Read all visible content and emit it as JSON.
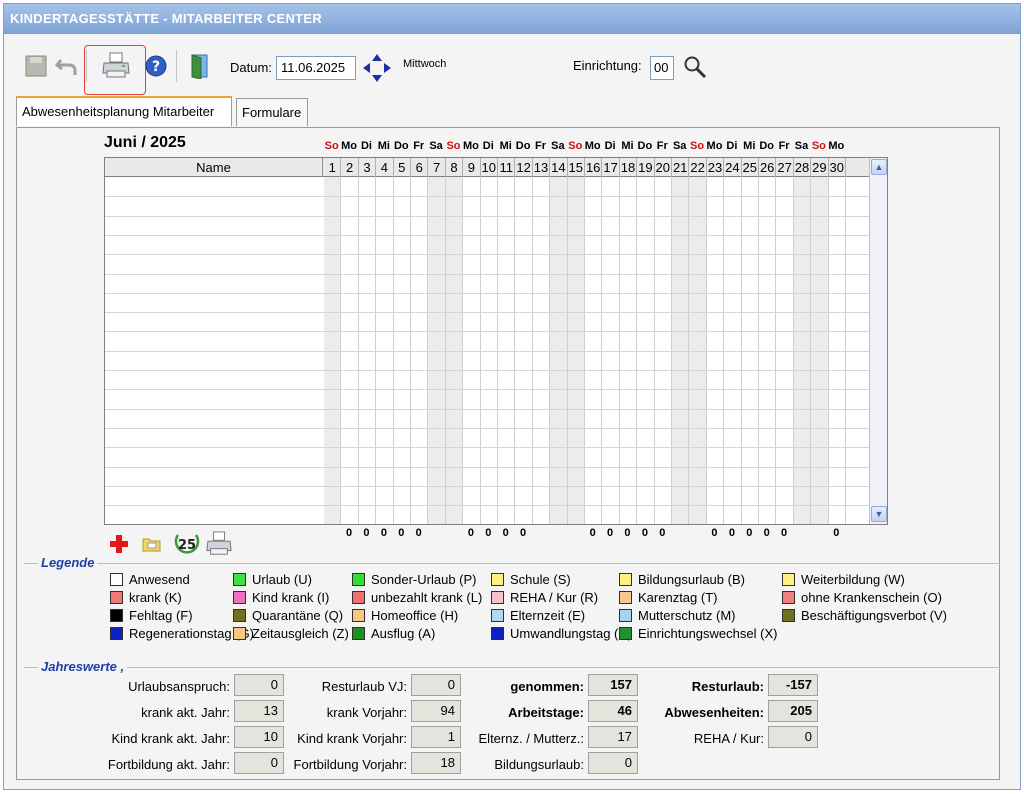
{
  "window": {
    "title": "KINDERTAGESSTÄTTE - MITARBEITER CENTER"
  },
  "toolbar": {
    "date_label": "Datum:",
    "date_value": "11.06.2025",
    "weekday": "Mittwoch",
    "facility_label": "Einrichtung:",
    "facility_value": "00",
    "icons": [
      "save-icon",
      "undo-icon",
      "print-icon",
      "help-icon",
      "exit-door-icon",
      "date-navigator-icon",
      "search-icon"
    ]
  },
  "tabs": [
    {
      "label": "Abwesenheitsplanung Mitarbeiter",
      "active": true
    },
    {
      "label": "Formulare",
      "active": false
    }
  ],
  "calendar": {
    "month_title": "Juni / 2025",
    "name_header": "Name",
    "days": [
      "So",
      "Mo",
      "Di",
      "Mi",
      "Do",
      "Fr",
      "Sa",
      "So",
      "Mo",
      "Di",
      "Mi",
      "Do",
      "Fr",
      "Sa",
      "So",
      "Mo",
      "Di",
      "Mi",
      "Do",
      "Fr",
      "Sa",
      "So",
      "Mo",
      "Di",
      "Mi",
      "Do",
      "Fr",
      "Sa",
      "So",
      "Mo"
    ],
    "day_numbers": [
      "1",
      "2",
      "3",
      "4",
      "5",
      "6",
      "7",
      "8",
      "9",
      "10",
      "11",
      "12",
      "13",
      "14",
      "15",
      "16",
      "17",
      "18",
      "19",
      "20",
      "21",
      "22",
      "23",
      "24",
      "25",
      "26",
      "27",
      "28",
      "29",
      "30"
    ],
    "totals": [
      "",
      "0",
      "0",
      "0",
      "0",
      "0",
      "",
      "",
      "0",
      "0",
      "0",
      "0",
      "",
      "",
      "",
      "0",
      "0",
      "0",
      "0",
      "0",
      "",
      "",
      "0",
      "0",
      "0",
      "0",
      "0",
      "",
      "",
      "0"
    ],
    "action_icons": [
      "add-icon",
      "open-folder-icon",
      "calendar-25-icon",
      "print-icon"
    ]
  },
  "legend": {
    "title": "Legende",
    "items": [
      {
        "label": "Anwesend",
        "color": "#ffffff"
      },
      {
        "label": "Urlaub (U)",
        "color": "#40e040"
      },
      {
        "label": "Sonder-Urlaub (P)",
        "color": "#30e030"
      },
      {
        "label": "Schule (S)",
        "color": "#fff080"
      },
      {
        "label": "Bildungsurlaub (B)",
        "color": "#fff080"
      },
      {
        "label": "Weiterbildung (W)",
        "color": "#fff080"
      },
      {
        "label": "krank (K)",
        "color": "#f07878"
      },
      {
        "label": "Kind krank (I)",
        "color": "#f070c0"
      },
      {
        "label": "unbezahlt krank (L)",
        "color": "#f07070"
      },
      {
        "label": "REHA / Kur (R)",
        "color": "#f8c0c8"
      },
      {
        "label": "Karenztag (T)",
        "color": "#f8c890"
      },
      {
        "label": "ohne Krankenschein (O)",
        "color": "#f08080"
      },
      {
        "label": "Fehltag (F)",
        "color": "#000000"
      },
      {
        "label": "Quarantäne (Q)",
        "color": "#707020"
      },
      {
        "label": "Homeoffice (H)",
        "color": "#f8c880"
      },
      {
        "label": "Elternzeit (E)",
        "color": "#b0d8f0"
      },
      {
        "label": "Mutterschutz (M)",
        "color": "#a8d4f0"
      },
      {
        "label": "Beschäftigungsverbot (V)",
        "color": "#707020"
      },
      {
        "label": "Regenerationstag (G)",
        "color": "#1020c0"
      },
      {
        "label": "Zeitausgleich (Z)",
        "color": "#f8c880"
      },
      {
        "label": "Ausflug (A)",
        "color": "#209020"
      },
      {
        "label": "Umwandlungstag (C)",
        "color": "#1020c0"
      },
      {
        "label": "Einrichtungswechsel (X)",
        "color": "#209030"
      }
    ]
  },
  "annual": {
    "title": "Jahreswerte ,",
    "urlaubsanspruch_label": "Urlaubsanspruch:",
    "urlaubsanspruch": "0",
    "resturlaub_vj_label": "Resturlaub VJ:",
    "resturlaub_vj": "0",
    "genommen_label": "genommen:",
    "genommen": "157",
    "resturlaub_label": "Resturlaub:",
    "resturlaub": "-157",
    "krank_akt_label": "krank akt. Jahr:",
    "krank_akt": "13",
    "krank_vj_label": "krank Vorjahr:",
    "krank_vj": "94",
    "arbeitstage_label": "Arbeitstage:",
    "arbeitstage": "46",
    "abwesenheiten_label": "Abwesenheiten:",
    "abwesenheiten": "205",
    "kindkrank_akt_label": "Kind krank akt. Jahr:",
    "kindkrank_akt": "10",
    "kindkrank_vj_label": "Kind krank Vorjahr:",
    "kindkrank_vj": "1",
    "elternz_label": "Elternz. / Mutterz.:",
    "elternz": "17",
    "reha_label": "REHA / Kur:",
    "reha": "0",
    "fortbildung_akt_label": "Fortbildung akt. Jahr:",
    "fortbildung_akt": "0",
    "fortbildung_vj_label": "Fortbildung Vorjahr:",
    "fortbildung_vj": "18",
    "bildungsurlaub_label": "Bildungsurlaub:",
    "bildungsurlaub": "0"
  }
}
